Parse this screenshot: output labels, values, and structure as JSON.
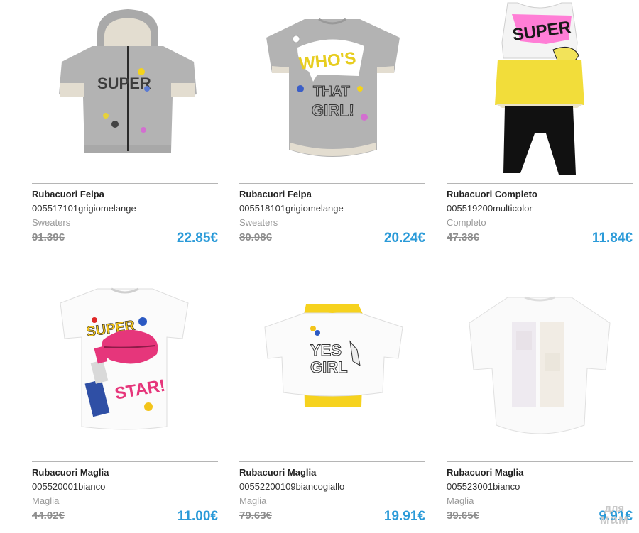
{
  "products": [
    {
      "brand": "Rubacuori Felpa",
      "code": "005517101grigiomelange",
      "category": "Sweaters",
      "old_price": "91.39€",
      "price": "22.85€",
      "image": "grey-hoodie-super"
    },
    {
      "brand": "Rubacuori Felpa",
      "code": "005518101grigiomelange",
      "category": "Sweaters",
      "old_price": "80.98€",
      "price": "20.24€",
      "image": "grey-tshirt-whos-that-girl"
    },
    {
      "brand": "Rubacuori Completo",
      "code": "005519200multicolor",
      "category": "Completo",
      "old_price": "47.38€",
      "price": "11.84€",
      "image": "super-top-and-black-leggings"
    },
    {
      "brand": "Rubacuori Maglia",
      "code": "005520001bianco",
      "category": "Maglia",
      "old_price": "44.02€",
      "price": "11.00€",
      "image": "white-tshirt-lips-lipstick"
    },
    {
      "brand": "Rubacuori Maglia",
      "code": "00552200109biancogiallo",
      "category": "Maglia",
      "old_price": "79.63€",
      "price": "19.91€",
      "image": "white-yellow-tshirt-yes-girl"
    },
    {
      "brand": "Rubacuori Maglia",
      "code": "005523001bianco",
      "category": "Maglia",
      "old_price": "39.65€",
      "price": "9.91€",
      "image": "white-tshirt-back"
    }
  ],
  "watermark": {
    "line1": "для",
    "line2": "мам"
  },
  "colors": {
    "price": "#2a9ad8",
    "old_price": "#8e8e8e",
    "category": "#9a9a9a"
  }
}
